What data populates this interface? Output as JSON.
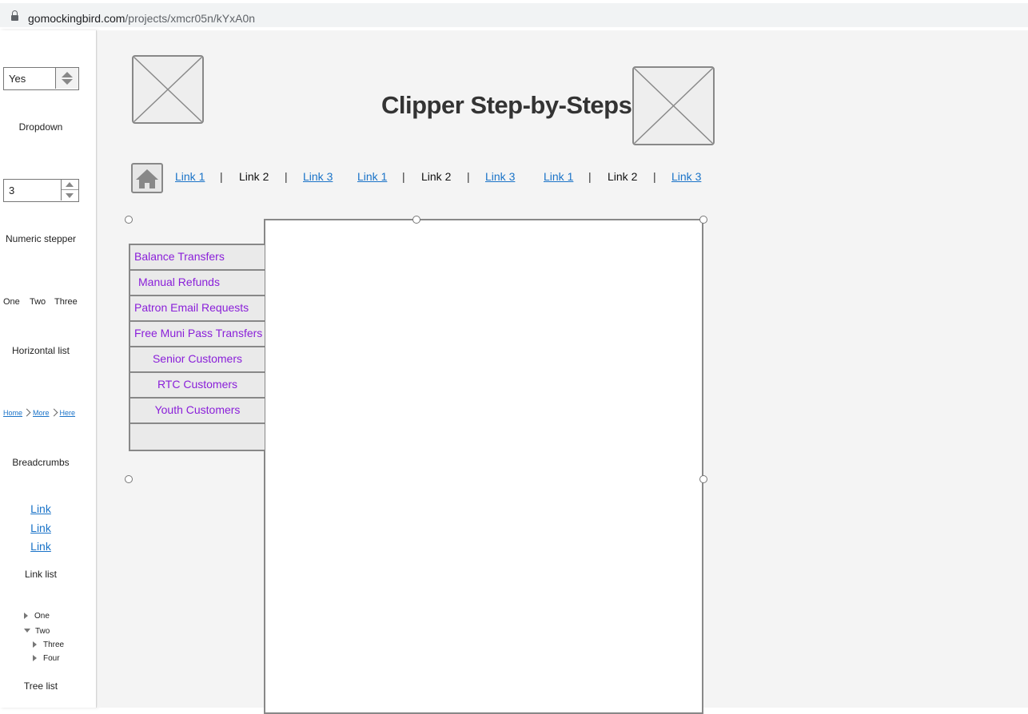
{
  "browser": {
    "url_domain": "gomockingbird.com",
    "url_path": "/projects/xmcr05n/kYxA0n"
  },
  "palette": {
    "dropdown": {
      "value": "Yes",
      "caption": "Dropdown"
    },
    "stepper": {
      "value": "3",
      "caption": "Numeric stepper"
    },
    "horizontal_list": {
      "items": [
        "One",
        "Two",
        "Three"
      ],
      "caption": "Horizontal list"
    },
    "breadcrumbs": {
      "items": [
        "Home",
        "More",
        "Here"
      ],
      "caption": "Breadcrumbs"
    },
    "link_list": {
      "items": [
        "Link",
        "Link",
        "Link"
      ],
      "caption": "Link list"
    },
    "tree_list": {
      "items": [
        "One",
        "Two",
        "Three",
        "Four"
      ],
      "caption": "Tree list"
    }
  },
  "canvas": {
    "title": "Clipper Step-by-Steps",
    "nav": [
      {
        "label": "Link 1",
        "type": "link"
      },
      {
        "label": "|",
        "type": "sep"
      },
      {
        "label": "Link 2",
        "type": "current"
      },
      {
        "label": "|",
        "type": "sep"
      },
      {
        "label": "Link 3",
        "type": "link"
      },
      {
        "label": "Link 1",
        "type": "link"
      },
      {
        "label": "|",
        "type": "sep"
      },
      {
        "label": "Link 2",
        "type": "current"
      },
      {
        "label": "|",
        "type": "sep"
      },
      {
        "label": "Link 3",
        "type": "link"
      },
      {
        "label": "Link 1",
        "type": "link"
      },
      {
        "label": "|",
        "type": "sep"
      },
      {
        "label": "Link 2",
        "type": "current"
      },
      {
        "label": "|",
        "type": "sep"
      },
      {
        "label": "Link 3",
        "type": "link"
      }
    ],
    "menu": [
      {
        "label": "Balance Transfers"
      },
      {
        "label": "Manual Refunds"
      },
      {
        "label": "Patron Email Requests"
      },
      {
        "label": "Free Muni Pass Transfers"
      },
      {
        "label": "Senior Customers"
      },
      {
        "label": "RTC Customers"
      },
      {
        "label": "Youth Customers"
      },
      {
        "label": ""
      }
    ]
  },
  "colors": {
    "link": "#1a73c8",
    "menu_text": "#8a1fd9",
    "canvas_bg": "#f4f4f4"
  }
}
